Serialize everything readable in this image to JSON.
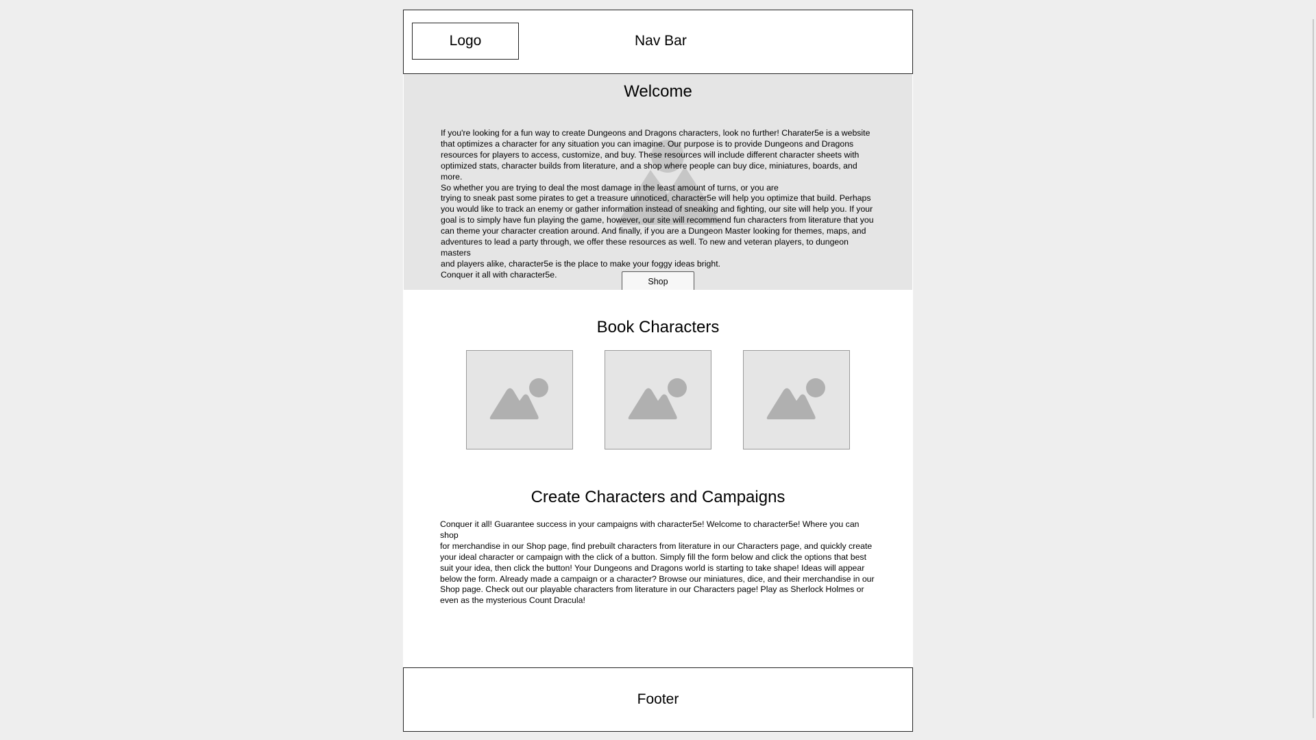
{
  "header": {
    "logo": "Logo",
    "nav": "Nav Bar"
  },
  "hero": {
    "title": "Welcome",
    "paragraph_lines": [
      "If you're looking for a fun way to create Dungeons and Dragons characters, look no further! Charater5e is a website",
      "that optimizes a character for any situation you can imagine. Our purpose is to provide Dungeons and Dragons",
      "resources for players to access, customize, and buy. These resources will include different character sheets with",
      "optimized stats, character builds from literature, and a shop where people can buy dice, miniatures, boards, and more.",
      "So whether you are trying to deal the most damage in the least amount of turns, or you are",
      "trying to sneak past some pirates to get a treasure unnoticed, character5e will help you optimize that build. Perhaps",
      "you would like to track an enemy or gather information instead of sneaking and fighting, our site will help you. If your",
      "goal is to simply have fun playing the game, however, our site will recommend fun characters from literature that you",
      "can theme your character creation around. And finally, if you are a Dungeon Master looking for themes, maps, and",
      "adventures to lead a party through, we offer these resources as well. To new and veteran players, to dungeon masters",
      "and players alike, character5e is the place to make your foggy ideas bright.",
      "Conquer it all with character5e."
    ],
    "shop_button": "Shop"
  },
  "book_characters": {
    "title": "Book Characters",
    "images": [
      "image-icon",
      "image-icon",
      "image-icon"
    ]
  },
  "create": {
    "title": "Create Characters and Campaigns",
    "paragraph_lines": [
      "Conquer it all! Guarantee success in your campaigns with character5e! Welcome to character5e! Where you can shop",
      "for merchandise in our Shop page, find prebuilt characters from literature in our Characters page, and quickly create",
      "your ideal character or campaign with the click of a button. Simply fill the form below and click the options that best",
      "suit your idea, then click the button! Your Dungeons and Dragons world is starting to take shape! Ideas will appear",
      "below the form. Already made a campaign or a character? Browse our miniatures, dice, and their merchandise in our",
      "Shop page. Check out our playable characters from literature in our Characters page! Play as Sherlock Holmes or",
      "even as the mysterious Count Dracula!"
    ]
  },
  "footer": {
    "label": "Footer"
  },
  "colors": {
    "page_bg": "#eeeeee",
    "section_bg": "#e5e5e5",
    "placeholder_icon": "#b0b0b0"
  }
}
